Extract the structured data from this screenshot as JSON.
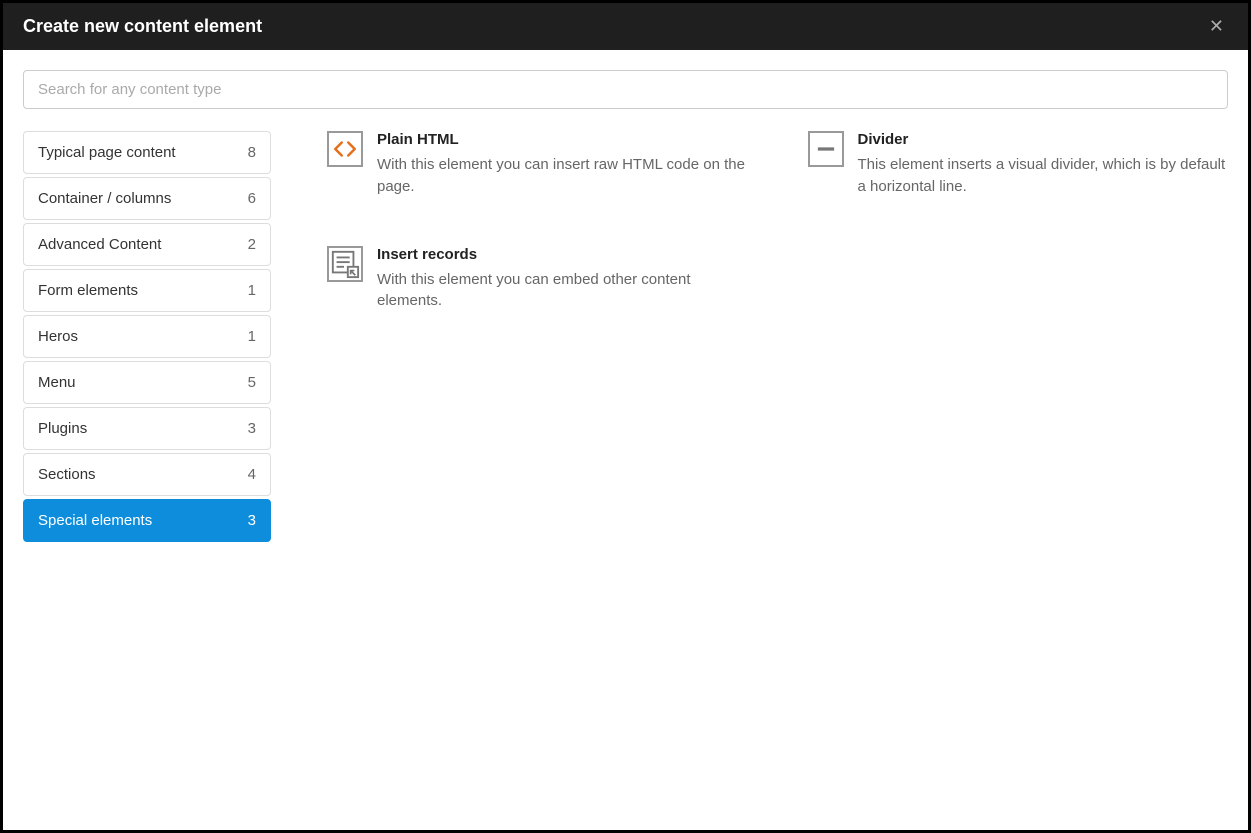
{
  "modal": {
    "title": "Create new content element"
  },
  "search": {
    "placeholder": "Search for any content type"
  },
  "sidebar": {
    "items": [
      {
        "label": "Typical page content",
        "count": "8",
        "active": false
      },
      {
        "label": "Container / columns",
        "count": "6",
        "active": false
      },
      {
        "label": "Advanced Content",
        "count": "2",
        "active": false
      },
      {
        "label": "Form elements",
        "count": "1",
        "active": false
      },
      {
        "label": "Heros",
        "count": "1",
        "active": false
      },
      {
        "label": "Menu",
        "count": "5",
        "active": false
      },
      {
        "label": "Plugins",
        "count": "3",
        "active": false
      },
      {
        "label": "Sections",
        "count": "4",
        "active": false
      },
      {
        "label": "Special elements",
        "count": "3",
        "active": true
      }
    ]
  },
  "elements": [
    {
      "icon": "html-icon",
      "title": "Plain HTML",
      "desc": "With this element you can insert raw HTML code on the page."
    },
    {
      "icon": "divider-icon",
      "title": "Divider",
      "desc": "This element inserts a visual divider, which is by default a horizontal line."
    },
    {
      "icon": "records-icon",
      "title": "Insert records",
      "desc": "With this element you can embed other content elements."
    }
  ]
}
